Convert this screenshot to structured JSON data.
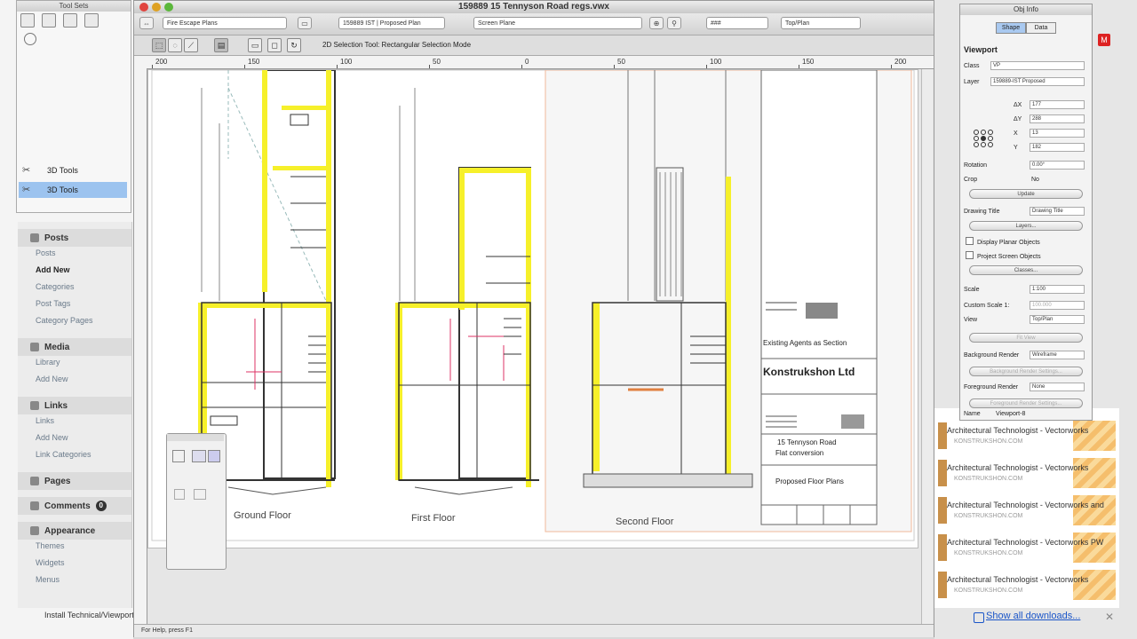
{
  "window": {
    "title": "159889 15 Tennyson Road regs.vwx",
    "view_fields": [
      "Fire Escape Plans",
      "159889 IST | Proposed Plan",
      "Screen Plane",
      "Top/Plan"
    ],
    "zoom": "###",
    "mode_bar_text": "2D Selection Tool: Rectangular Selection Mode",
    "ruler_ticks": [
      "200",
      "150",
      "100",
      "50",
      "0",
      "50",
      "100",
      "150",
      "200"
    ],
    "status_text": "For Help, press F1"
  },
  "tool_sets": {
    "title": "Tool Sets",
    "items": [
      {
        "label": "3D Tools",
        "selected": false
      },
      {
        "label": "3D Tools",
        "selected": true
      }
    ]
  },
  "wp_menu": {
    "sections": [
      {
        "title": "Posts",
        "items": [
          "Posts",
          "Add New",
          "Categories",
          "Post Tags",
          "Category Pages"
        ],
        "active_item": "Add New"
      },
      {
        "title": "Media",
        "items": [
          "Library",
          "Add New"
        ]
      },
      {
        "title": "Links",
        "items": [
          "Links",
          "Add New",
          "Link Categories"
        ]
      },
      {
        "title": "Pages",
        "items": []
      },
      {
        "title": "Comments",
        "items": [],
        "badge": "0"
      },
      {
        "title": "Appearance",
        "items": [
          "Themes",
          "Widgets",
          "Menus"
        ]
      }
    ],
    "bottom_text": "Install Technical/Viewports"
  },
  "drawing": {
    "floor_labels": [
      "Ground Floor",
      "First Floor",
      "Second Floor"
    ],
    "title_block": {
      "company": "Konstrukshon Ltd",
      "address_line1": "15 Tennyson Road",
      "address_line2": "Flat conversion",
      "drawing_title": "Proposed Floor Plans",
      "notes": "Existing Agents as Section"
    }
  },
  "obj_info": {
    "title": "Obj Info",
    "tabs": [
      "Shape",
      "Data"
    ],
    "section": "Viewport",
    "class_label": "Class",
    "class_value": "VP",
    "layer_label": "Layer",
    "layer_value": "159889-IST Proposed",
    "dims": [
      {
        "label": "ΔX",
        "value": "177"
      },
      {
        "label": "ΔY",
        "value": "288"
      },
      {
        "label": "X",
        "value": "13"
      },
      {
        "label": "Y",
        "value": "182"
      }
    ],
    "rotation_label": "Rotation",
    "rotation_value": "0.00°",
    "crop_label": "Crop",
    "crop_value": "No",
    "create_button": "Update",
    "drawing_title_label": "Drawing Title",
    "drawing_title_value": "Drawing Title",
    "layers_button": "Layers...",
    "checks": [
      "Display Planar Objects",
      "Project Screen Objects"
    ],
    "classes_button": "Classes...",
    "scale_label": "Scale",
    "scale_value": "1:100",
    "custom_scale_label": "Custom Scale 1:",
    "custom_scale_value": "100.000",
    "view_label": "View",
    "view_value": "Top/Plan",
    "fit_button": "Fit View",
    "bg_render_label": "Background Render",
    "bg_render_value": "Wireframe",
    "bg_render_settings": "Background Render Settings...",
    "fg_render_label": "Foreground Render",
    "fg_render_value": "None",
    "fg_render_settings": "Foreground Render Settings...",
    "name_label": "Name",
    "name_value": "Viewport-8"
  },
  "downloads": {
    "items": [
      {
        "title": "Architectural Technologist - Vectorworks",
        "sub": "KONSTRUKSHON.COM"
      },
      {
        "title": "Architectural Technologist - Vectorworks",
        "sub": "KONSTRUKSHON.COM"
      },
      {
        "title": "Architectural Technologist - Vectorworks and",
        "sub": "KONSTRUKSHON.COM"
      },
      {
        "title": "Architectural Technologist - Vectorworks PW",
        "sub": "KONSTRUKSHON.COM"
      },
      {
        "title": "Architectural Technologist - Vectorworks",
        "sub": "KONSTRUKSHON.COM"
      }
    ],
    "show_all": "Show all downloads..."
  },
  "colors": {
    "wall_highlight": "#f6f02a",
    "selection": "#9cc3ef",
    "link": "#1a55c8",
    "download_stripe": "#f2a93b"
  }
}
